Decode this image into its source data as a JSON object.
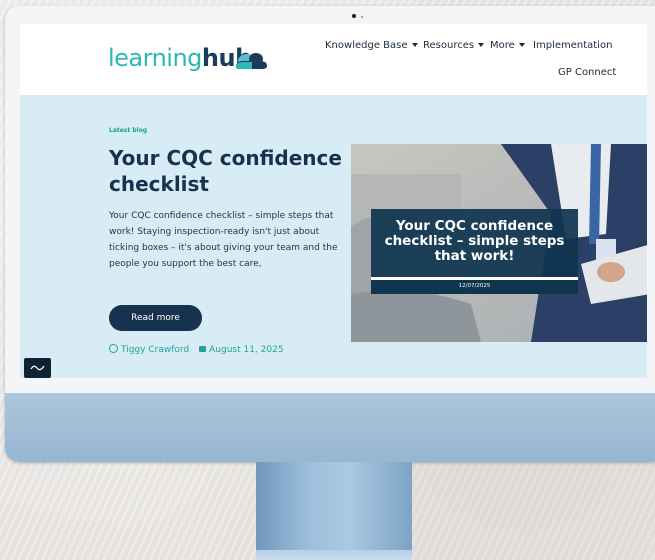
{
  "brand": {
    "name_part1": "learning",
    "name_part2": "hub",
    "colors": {
      "teal": "#2cb8b4",
      "navy": "#16324f",
      "screen_bg": "#d7ecf5"
    }
  },
  "nav": {
    "items": [
      {
        "label": "Knowledge Base",
        "dropdown": true
      },
      {
        "label": "Resources",
        "dropdown": true
      },
      {
        "label": "More",
        "dropdown": true
      },
      {
        "label": "Implementation",
        "dropdown": false
      },
      {
        "label": "GP Connect",
        "dropdown": false
      }
    ]
  },
  "hero": {
    "kicker": "Latest blog",
    "title": "Your CQC confidence checklist",
    "excerpt": "Your CQC confidence checklist – simple steps that work! Staying inspection-ready isn't just about ticking boxes – it's about giving your team and the people you support the best care,",
    "read_more": "Read more",
    "author": "Tiggy Crawford",
    "date": "August 11, 2025"
  },
  "feature_image": {
    "overlay_title": "Your CQC confidence checklist – simple steps that work!",
    "overlay_date": "12/07/2025"
  },
  "icons": {
    "logo": "cloud-logo-icon",
    "author": "user-circle-icon",
    "date": "calendar-icon",
    "chat": "chat-icon"
  }
}
